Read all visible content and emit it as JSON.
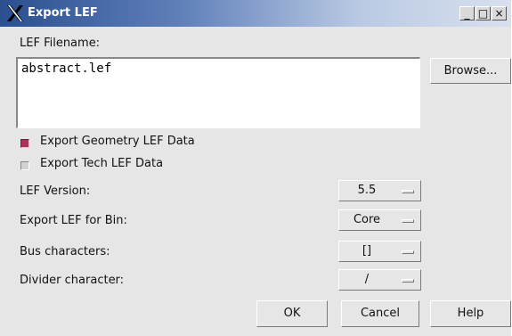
{
  "window": {
    "title": "Export LEF",
    "controls": [
      "_",
      "□",
      "×"
    ]
  },
  "filename": {
    "label": "LEF Filename:",
    "value": "abstract.lef",
    "browse_label": "Browse..."
  },
  "options": [
    {
      "label": "Export Geometry LEF Data",
      "checked": true
    },
    {
      "label": "Export Tech LEF Data",
      "checked": false
    }
  ],
  "settings": {
    "lef_version": {
      "label": "LEF Version:",
      "value": "5.5"
    },
    "bin": {
      "label": "Export LEF for Bin:",
      "value": "Core"
    },
    "bus": {
      "label": "Bus characters:",
      "value": "[]"
    },
    "divider": {
      "label": "Divider character:",
      "value": "/"
    }
  },
  "buttons": {
    "ok": "OK",
    "cancel": "Cancel",
    "help": "Help"
  }
}
